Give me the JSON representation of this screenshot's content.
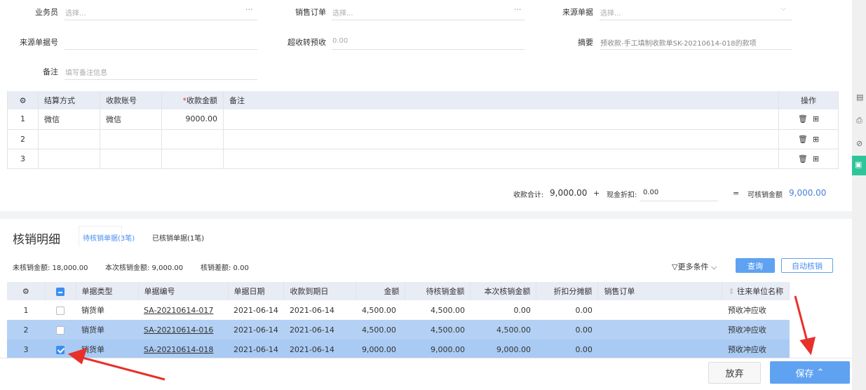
{
  "form": {
    "salesman": {
      "label": "业务员",
      "placeholder": "选择..."
    },
    "sales_order": {
      "label": "销售订单",
      "placeholder": "选择..."
    },
    "source_doc": {
      "label": "来源单据",
      "placeholder": "选择..."
    },
    "source_doc_no": {
      "label": "来源单据号",
      "value": ""
    },
    "over_receipt": {
      "label": "超收转预收",
      "value": "0.00"
    },
    "summary": {
      "label": "摘要",
      "value": "预收款-手工填制收款单SK-20210614-018的款项"
    },
    "remark": {
      "label": "备注",
      "placeholder": "填写备注信息"
    },
    "more_icon": "ellipsis-icon"
  },
  "payment_table": {
    "headers": [
      "结算方式",
      "收款账号",
      "收款金额",
      "备注",
      "操作"
    ],
    "rows": [
      {
        "no": "1",
        "method": "微信",
        "account": "微信",
        "amount": "9000.00",
        "remark": ""
      },
      {
        "no": "2",
        "method": "",
        "account": "",
        "amount": "",
        "remark": ""
      },
      {
        "no": "3",
        "method": "",
        "account": "",
        "amount": "",
        "remark": ""
      }
    ]
  },
  "totals": {
    "receipt_label": "收款合计:",
    "receipt_value": "9,000.00",
    "plus": "+",
    "discount_label": "现金折扣:",
    "discount_value": "0.00",
    "eq": "=",
    "writeoff_label": "可核销金额",
    "writeoff_value": "9,000.00"
  },
  "writeoff": {
    "title": "核销明细",
    "tabs": [
      {
        "label": "待核销单据(3笔)",
        "active": true
      },
      {
        "label": "已核销单据(1笔)",
        "active": false
      }
    ],
    "unwritten_label": "未核销金额: 18,000.00",
    "current_label": "本次核销金额: 9,000.00",
    "diff_label": "核销差额: 0.00",
    "more_filters": "更多条件",
    "query": "查询",
    "auto": "自动核销",
    "headers": [
      "单据类型",
      "单据编号",
      "单据日期",
      "收款到期日",
      "金额",
      "待核销金额",
      "本次核销金额",
      "折扣分摊额",
      "销售订单",
      "往来单位名称"
    ],
    "rows": [
      {
        "no": "1",
        "checked": false,
        "type": "销货单",
        "code": "SA-20210614-017",
        "date": "2021-06-14",
        "due": "2021-06-14",
        "amount": "4,500.00",
        "pending": "4,500.00",
        "current": "0.00",
        "discount": "0.00",
        "order": "",
        "partner": "预收冲应收"
      },
      {
        "no": "2",
        "checked": false,
        "type": "销货单",
        "code": "SA-20210614-016",
        "date": "2021-06-14",
        "due": "2021-06-14",
        "amount": "4,500.00",
        "pending": "4,500.00",
        "current": "4,500.00",
        "discount": "0.00",
        "order": "",
        "partner": "预收冲应收"
      },
      {
        "no": "3",
        "checked": true,
        "type": "销货单",
        "code": "SA-20210614-018",
        "date": "2021-06-14",
        "due": "2021-06-14",
        "amount": "9,000.00",
        "pending": "9,000.00",
        "current": "9,000.00",
        "discount": "0.00",
        "order": "",
        "partner": "预收冲应收"
      }
    ]
  },
  "footer": {
    "discard": "放弃",
    "save": "保存"
  },
  "colors": {
    "accent": "#3d8ef0",
    "header_bg": "#e8ecf5",
    "selected_row": "#b4d1f5",
    "side_green": "#2fc59a",
    "annotation_arrow": "#e8302a"
  }
}
